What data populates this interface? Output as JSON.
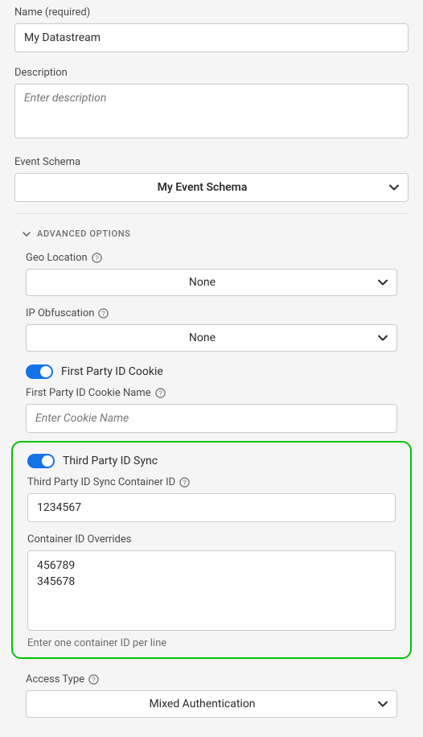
{
  "name": {
    "label": "Name (required)",
    "value": "My Datastream"
  },
  "description": {
    "label": "Description",
    "placeholder": "Enter description",
    "value": ""
  },
  "eventSchema": {
    "label": "Event Schema",
    "value": "My Event Schema"
  },
  "advanced": {
    "header": "ADVANCED OPTIONS",
    "geoLocation": {
      "label": "Geo Location",
      "value": "None"
    },
    "ipObfuscation": {
      "label": "IP Obfuscation",
      "value": "None"
    },
    "firstPartyCookie": {
      "switchLabel": "First Party ID Cookie",
      "nameLabel": "First Party ID Cookie Name",
      "placeholder": "Enter Cookie Name",
      "value": ""
    },
    "thirdPartySync": {
      "switchLabel": "Third Party ID Sync",
      "containerIdLabel": "Third Party ID Sync Container ID",
      "containerIdValue": "1234567",
      "overridesLabel": "Container ID Overrides",
      "overridesValue": "456789\n345678",
      "hint": "Enter one container ID per line"
    },
    "accessType": {
      "label": "Access Type",
      "value": "Mixed Authentication"
    }
  }
}
